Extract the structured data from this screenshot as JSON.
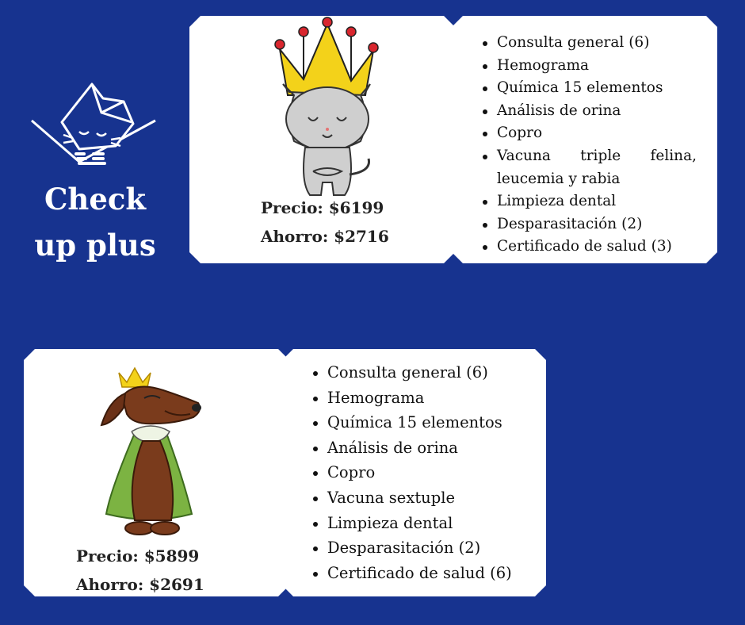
{
  "logo": {
    "icon": "cat-crate-icon"
  },
  "title": {
    "line1": "Check",
    "line2": "up plus"
  },
  "cat_plan": {
    "illustration": "crowned-cat-icon",
    "price": "Precio: $6199",
    "savings": "Ahorro: $2716",
    "items": [
      "Consulta general (6)",
      "Hemograma",
      "Química 15 elementos",
      "Análisis de orina",
      "Copro",
      "Vacuna triple felina, leucemia y rabia",
      "Limpieza dental",
      "Desparasitación (2)",
      "Certificado de salud (3)"
    ]
  },
  "dog_plan": {
    "illustration": "crowned-dog-icon",
    "price": "Precio: $5899",
    "savings": "Ahorro: $2691",
    "items": [
      "Consulta general (6)",
      "Hemograma",
      "Química 15 elementos",
      "Análisis de orina",
      "Copro",
      "Vacuna sextuple",
      "Limpieza dental",
      "Desparasitación (2)",
      "Certificado de salud (6)"
    ]
  },
  "colors": {
    "background": "#17338f",
    "card": "#ffffff",
    "crown": "#f3d21a",
    "cape": "#7cb342",
    "dog": "#7a3b1c"
  }
}
